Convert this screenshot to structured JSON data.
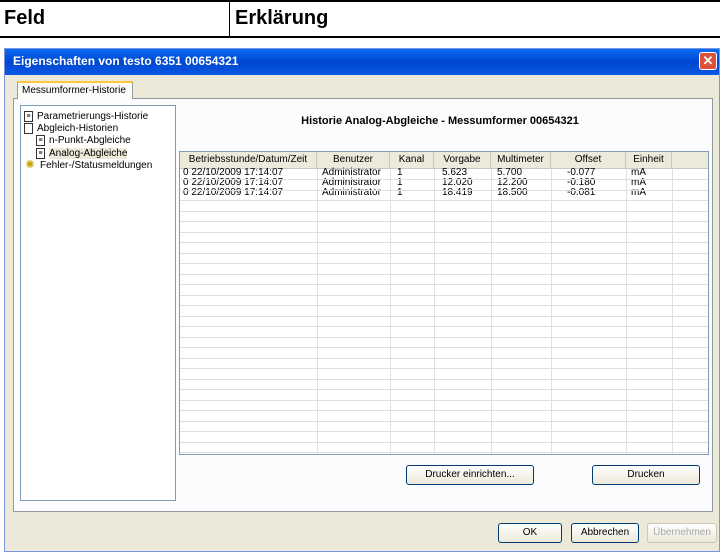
{
  "doc_header": {
    "col1": "Feld",
    "col2": "Erklärung"
  },
  "window": {
    "title": "Eigenschaften von testo 6351  00654321",
    "close_symbol": "✕"
  },
  "tab": {
    "label": "Messumformer-Historie"
  },
  "tree": {
    "items": [
      {
        "label": "Parametrierungs-Historie",
        "icon": "document-icon"
      },
      {
        "label": "Abgleich-Historien",
        "icon": "page-icon"
      },
      {
        "label": "n-Punkt-Abgleiche",
        "icon": "document-icon"
      },
      {
        "label": "Analog-Abgleiche",
        "icon": "document-icon"
      },
      {
        "label": "Fehler-/Statusmeldungen",
        "icon": "warning-icon"
      }
    ]
  },
  "section_title": "Historie Analog-Abgleiche - Messumformer 00654321",
  "table": {
    "columns": [
      "Betriebsstunde/Datum/Zeit",
      "Benutzer",
      "Kanal",
      "Vorgabe",
      "Multimeter",
      "Offset",
      "Einheit"
    ],
    "rows": [
      [
        "0 22/10/2009 17:14:07",
        "Administrator",
        "1",
        "5.623",
        "5.700",
        "-0.077",
        "mA"
      ],
      [
        "0 22/10/2009 17:14:07",
        "Administrator",
        "1",
        "12.020",
        "12.200",
        "-0.180",
        "mA"
      ],
      [
        "0 22/10/2009 17:14:07",
        "Administrator",
        "1",
        "18.419",
        "18.500",
        "-0.081",
        "mA"
      ]
    ]
  },
  "buttons": {
    "printer_setup": "Drucker einrichten...",
    "print": "Drucken",
    "ok": "OK",
    "cancel": "Abbrechen",
    "apply": "Übernehmen"
  }
}
